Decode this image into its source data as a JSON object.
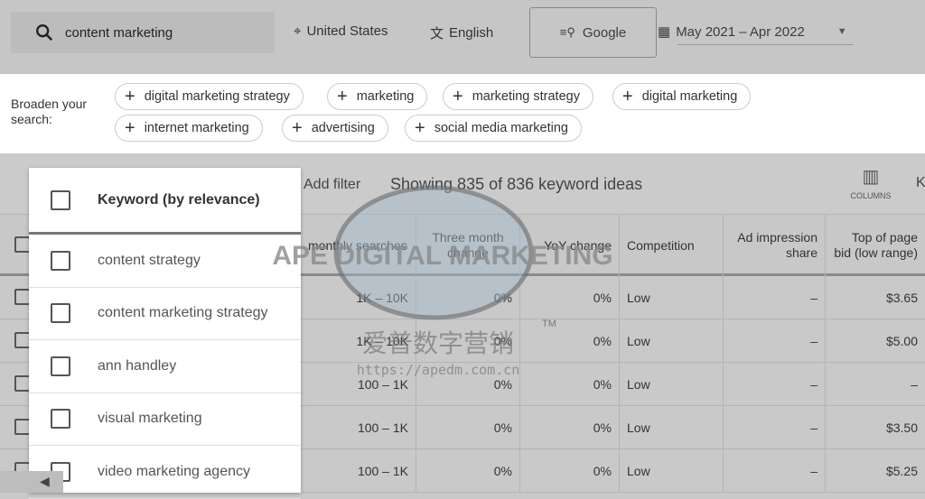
{
  "search": {
    "query": "content marketing",
    "location": "United States",
    "language": "English",
    "engine": "Google",
    "date_range": "May 2021 – Apr 2022"
  },
  "broaden": {
    "label": "Broaden your search:",
    "chips": [
      "digital marketing strategy",
      "marketing",
      "marketing strategy",
      "digital marketing",
      "internet marketing",
      "advertising",
      "social media marketing"
    ]
  },
  "toolbar": {
    "add_filter": "Add filter",
    "showing": "Showing 835 of 836 keyword ideas",
    "columns": "COLUMNS",
    "more": "K"
  },
  "table": {
    "headers": [
      "monthly searches",
      "Three month change",
      "YoY change",
      "Competition",
      "Ad impression share",
      "Top of page bid (low range)"
    ],
    "rows": [
      [
        "1K – 10K",
        "0%",
        "0%",
        "Low",
        "–",
        "$3.65"
      ],
      [
        "1K – 10K",
        "0%",
        "0%",
        "Low",
        "–",
        "$5.00"
      ],
      [
        "100 – 1K",
        "0%",
        "0%",
        "Low",
        "–",
        "–"
      ],
      [
        "100 – 1K",
        "0%",
        "0%",
        "Low",
        "–",
        "$3.50"
      ],
      [
        "100 – 1K",
        "0%",
        "0%",
        "Low",
        "–",
        "$5.25"
      ]
    ]
  },
  "panel": {
    "header": "Keyword (by relevance)",
    "items": [
      "content strategy",
      "content marketing strategy",
      "ann handley",
      "visual marketing",
      "video marketing agency"
    ]
  },
  "watermark": {
    "text": "APE DIGITAL MARKETING",
    "cn": "爱普数字营销",
    "url": "https://apedm.com.cn",
    "tm": "TM"
  }
}
